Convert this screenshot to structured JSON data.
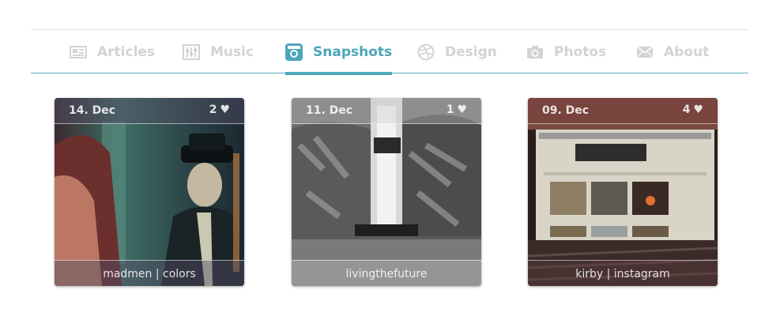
{
  "nav": {
    "tabs": [
      {
        "label": "Articles",
        "icon": "newspaper-icon",
        "active": false
      },
      {
        "label": "Music",
        "icon": "mixer-sliders-icon",
        "active": false
      },
      {
        "label": "Snapshots",
        "icon": "instagram-camera-icon",
        "active": true
      },
      {
        "label": "Design",
        "icon": "dribbble-ball-icon",
        "active": false
      },
      {
        "label": "Photos",
        "icon": "camera-icon",
        "active": false
      },
      {
        "label": "About",
        "icon": "envelope-icon",
        "active": false
      }
    ]
  },
  "snapshots": [
    {
      "date": "14. Dec",
      "likes": "2",
      "caption": "madmen | colors"
    },
    {
      "date": "11. Dec",
      "likes": "1",
      "caption": "livingthefuture"
    },
    {
      "date": "09. Dec",
      "likes": "4",
      "caption": "kirby | instagram"
    }
  ],
  "colors": {
    "accent": "#4ba6b8",
    "inactive": "#d3d3d3",
    "divider": "#5aaebc"
  }
}
